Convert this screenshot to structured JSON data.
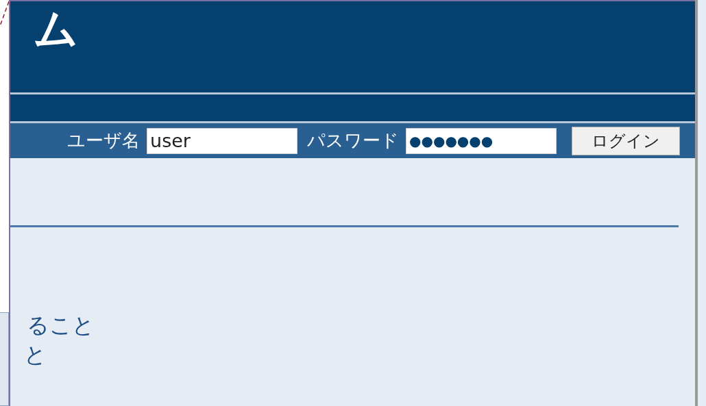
{
  "header": {
    "title": "ム"
  },
  "login_bar": {
    "username_label": "ユーザ名",
    "username_value": "user",
    "password_label": "パスワード",
    "password_value": "●●●●●●●",
    "login_button": "ログイン"
  },
  "content": {
    "lines": [
      "ること",
      "と"
    ]
  }
}
